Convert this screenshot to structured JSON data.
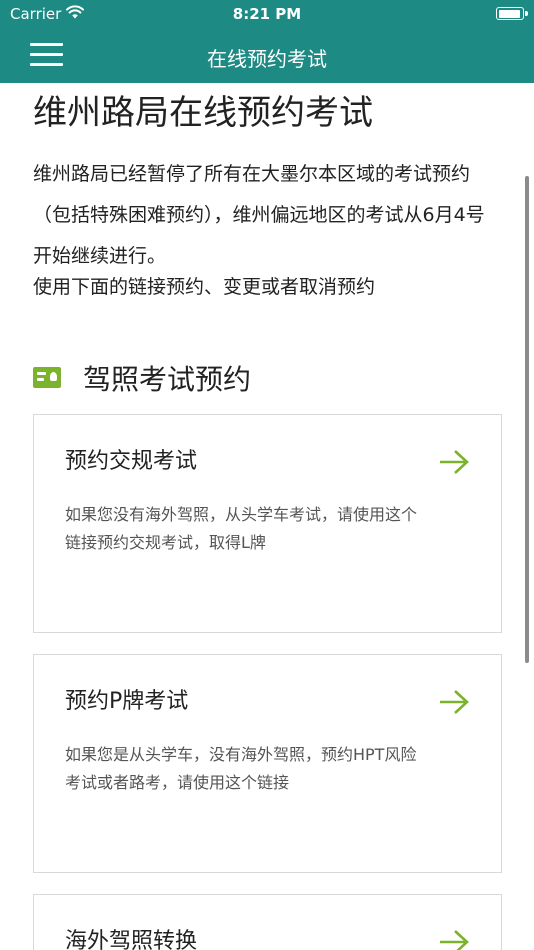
{
  "status_bar": {
    "carrier": "Carrier",
    "time": "8:21 PM"
  },
  "nav": {
    "title": "在线预约考试",
    "menu_icon": "hamburger-menu-icon"
  },
  "main": {
    "title": "维州路局在线预约考试",
    "intro": "维州路局已经暂停了所有在大墨尔本区域的考试预约（包括特殊困难预约），维州偏远地区的考试从6月4号开始继续进行。",
    "instruction": "使用下面的链接预约、变更或者取消预约",
    "section": {
      "icon": "id-card-icon",
      "title": "驾照考试预约"
    },
    "cards": [
      {
        "title": "预约交规考试",
        "desc": "如果您没有海外驾照，从头学车考试，请使用这个链接预约交规考试，取得L牌",
        "arrow_icon": "arrow-right-icon"
      },
      {
        "title": "预约P牌考试",
        "desc": "如果您是从头学车，没有海外驾照，预约HPT风险考试或者路考，请使用这个链接",
        "arrow_icon": "arrow-right-icon"
      },
      {
        "title": "海外驾照转换",
        "desc": "",
        "arrow_icon": "arrow-right-icon"
      }
    ]
  },
  "colors": {
    "header": "#1d8a84",
    "accent": "#7cb32d",
    "card_border": "#d8d8d8"
  }
}
